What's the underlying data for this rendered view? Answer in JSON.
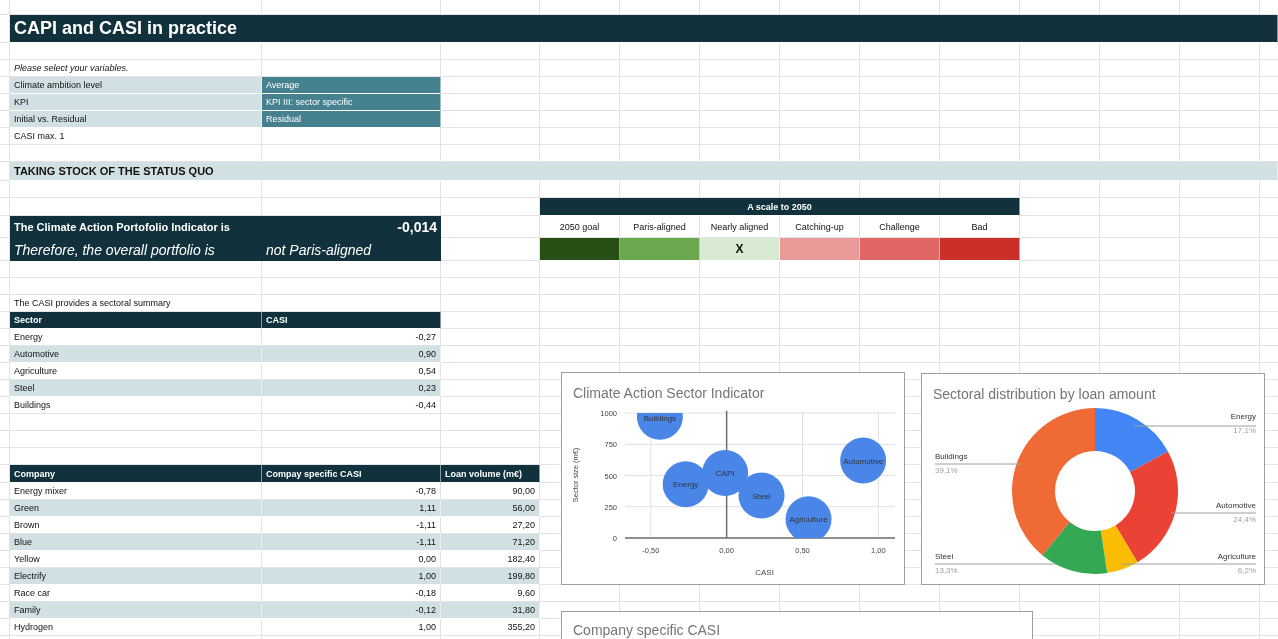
{
  "title": "CAPI and CASI in practice",
  "variables": {
    "prompt": "Please select your variables.",
    "rows": [
      {
        "label": "Climate ambition level",
        "value": "Average"
      },
      {
        "label": "KPI",
        "value": "KPI III: sector specific"
      },
      {
        "label": "Initial vs. Residual",
        "value": "Residual"
      }
    ],
    "note": "CASI max. 1"
  },
  "section_heading": "TAKING STOCK OF THE STATUS QUO",
  "indicator": {
    "label": "The Climate Action Portofolio Indicator is",
    "value": "-0,014",
    "conclusion_label": "Therefore, the overall portfolio is",
    "conclusion": "not Paris-aligned"
  },
  "scale": {
    "title": "A scale to 2050",
    "marker": "X",
    "levels": [
      {
        "label": "2050 goal",
        "color": "#274e13",
        "selected": false
      },
      {
        "label": "Paris-aligned",
        "color": "#6aa84f",
        "selected": false
      },
      {
        "label": "Nearly aligned",
        "color": "#d9ead3",
        "selected": true
      },
      {
        "label": "Catching-up",
        "color": "#ea9999",
        "selected": false
      },
      {
        "label": "Challenge",
        "color": "#e06666",
        "selected": false
      },
      {
        "label": "Bad",
        "color": "#cc2f27",
        "selected": false
      }
    ]
  },
  "sector_table": {
    "caption": "The CASI provides a sectoral summary",
    "columns": [
      "Sector",
      "CASI"
    ],
    "rows": [
      [
        "Energy",
        "-0,27"
      ],
      [
        "Automotive",
        "0,90"
      ],
      [
        "Agriculture",
        "0,54"
      ],
      [
        "Steel",
        "0,23"
      ],
      [
        "Buildings",
        "-0,44"
      ]
    ]
  },
  "company_table": {
    "columns": [
      "Company",
      "Compay specific CASI",
      "Loan volume (m€)"
    ],
    "rows": [
      [
        "Energy mixer",
        "-0,78",
        "90,00"
      ],
      [
        "Green",
        "1,11",
        "56,00"
      ],
      [
        "Brown",
        "-1,11",
        "27,20"
      ],
      [
        "Blue",
        "-1,11",
        "71,20"
      ],
      [
        "Yellow",
        "0,00",
        "182,40"
      ],
      [
        "Electrify",
        "1,00",
        "199,80"
      ],
      [
        "Race car",
        "-0,18",
        "9,60"
      ],
      [
        "Family",
        "-0,12",
        "31,80"
      ],
      [
        "Hydrogen",
        "1,00",
        "355,20"
      ]
    ]
  },
  "charts": [
    {
      "chart_data": {
        "type": "scatter",
        "title": "Climate Action Sector Indicator",
        "xlabel": "CASI",
        "ylabel": "Sector size (m€)",
        "x": [
          -0.44,
          -0.27,
          -0.01,
          0.23,
          0.54,
          0.9
        ],
        "series": [
          {
            "color": "#4a86e8",
            "values": [
              970,
              430,
              520,
              340,
              150,
              620
            ]
          }
        ],
        "xlim": [
          -0.67,
          1.11
        ],
        "ylim": [
          0,
          1000
        ],
        "grid": true,
        "xticks": [
          {
            "value": -0.5,
            "label": "-0,50"
          },
          {
            "value": 0,
            "label": "0,00"
          },
          {
            "value": 0.5,
            "label": "0,50"
          },
          {
            "value": 1,
            "label": "1,00"
          }
        ],
        "yticks": [
          0,
          250,
          500,
          750,
          1000
        ],
        "ref_lines": [
          {
            "axis": "x",
            "value": 0
          }
        ],
        "annotations": [
          {
            "text": "Buildings",
            "x": -0.44,
            "y": 970
          },
          {
            "text": "Energy",
            "x": -0.27,
            "y": 430
          },
          {
            "text": "CAPI",
            "x": -0.01,
            "y": 520
          },
          {
            "text": "Steel",
            "x": 0.23,
            "y": 340
          },
          {
            "text": "Agriculture",
            "x": 0.54,
            "y": 150
          },
          {
            "text": "Automotive",
            "x": 0.9,
            "y": 620
          }
        ]
      }
    },
    {
      "chart_data": {
        "type": "donut",
        "title": "Sectoral distribution by loan amount",
        "categories": [
          "Energy",
          "Automotive",
          "Agriculture",
          "Steel",
          "Buildings"
        ],
        "values": [
          17.1,
          24.4,
          6.2,
          13.3,
          39.1
        ],
        "colors": [
          "#4285f4",
          "#ea4335",
          "#fbbc04",
          "#34a853",
          "#f06a35"
        ],
        "value_labels": [
          "17,1%",
          "24,4%",
          "6,2%",
          "13,3%",
          "39,1%"
        ]
      }
    },
    {
      "title": "Company specific CASI"
    }
  ]
}
